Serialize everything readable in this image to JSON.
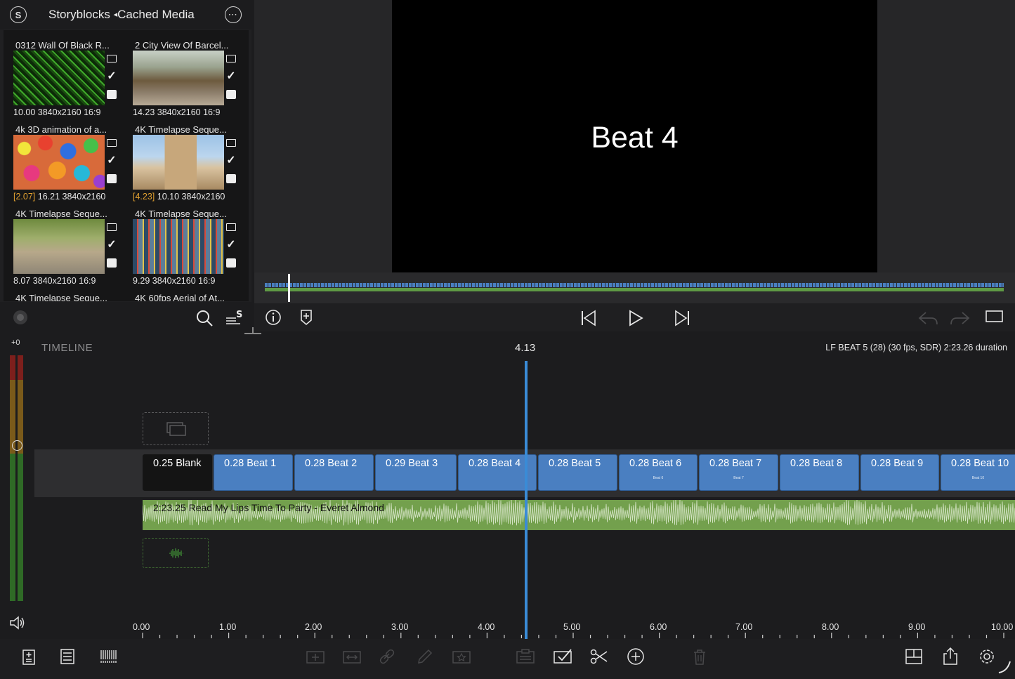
{
  "browser": {
    "title": "Storyblocks",
    "title_arrow": "◂",
    "title_sub": "Cached Media",
    "items": [
      {
        "name": "0312 Wall Of Black R...",
        "tag": "",
        "meta": "10.00  3840x2160  16:9"
      },
      {
        "name": "2 City View Of Barcel...",
        "tag": "",
        "meta": "14.23  3840x2160  16:9"
      },
      {
        "name": "4k 3D animation of a...",
        "tag": "[2.07]",
        "meta": "  16.21  3840x2160"
      },
      {
        "name": "4K Timelapse Seque...",
        "tag": "[4.23]",
        "meta": "  10.10  3840x2160"
      },
      {
        "name": "4K Timelapse Seque...",
        "tag": "",
        "meta": "8.07  3840x2160  16:9"
      },
      {
        "name": "4K Timelapse Seque...",
        "tag": "",
        "meta": "9.29  3840x2160  16:9"
      },
      {
        "name": "4K Timelapse Seque...",
        "tag": "",
        "meta": ""
      },
      {
        "name": "4K 60fps Aerial of At...",
        "tag": "",
        "meta": ""
      }
    ]
  },
  "viewer": {
    "frame_text": "Beat 4"
  },
  "timeline": {
    "label": "TIMELINE",
    "playhead_time": "4.13",
    "project_info": "LF BEAT 5 (28) (30 fps, SDR)  2:23.26 duration",
    "meter_label": "+0",
    "clips": [
      {
        "label": "0.25   Blank",
        "sub": ""
      },
      {
        "label": "0.28   Beat 1",
        "sub": ""
      },
      {
        "label": "0.28   Beat 2",
        "sub": ""
      },
      {
        "label": "0.29   Beat 3",
        "sub": ""
      },
      {
        "label": "0.28   Beat 4",
        "sub": ""
      },
      {
        "label": "0.28   Beat 5",
        "sub": ""
      },
      {
        "label": "0.28   Beat 6",
        "sub": "Beat 6"
      },
      {
        "label": "0.28   Beat 7",
        "sub": "Beat 7"
      },
      {
        "label": "0.28   Beat 8",
        "sub": ""
      },
      {
        "label": "0.28   Beat 9",
        "sub": ""
      },
      {
        "label": "0.28   Beat 10",
        "sub": "Beat 10"
      }
    ],
    "audio_label": "2:23.25  Read My Lips Time To Party - Everet Almond",
    "ruler_labels": [
      "0.00",
      "1.00",
      "2.00",
      "3.00",
      "4.00",
      "5.00",
      "6.00",
      "7.00",
      "8.00",
      "9.00",
      "10.00"
    ]
  },
  "colors": {
    "video_clip": "#4a7fc1",
    "audio_clip": "#7eaa55",
    "playhead": "#3a8bd6",
    "used_tag": "#e0a030"
  },
  "icons": {
    "browser": [
      "storyblocks-icon",
      "more-icon",
      "record-icon",
      "search-icon",
      "sort-icon"
    ],
    "transport": [
      "info-icon",
      "add-marker-icon",
      "skip-back-icon",
      "play-icon",
      "skip-forward-icon",
      "undo-icon",
      "redo-icon",
      "fullscreen-icon"
    ],
    "toolbar": [
      "add-media-icon",
      "list-view-icon",
      "barcode-icon",
      "add-title-icon",
      "add-transition-icon",
      "link-icon",
      "edit-icon",
      "favorite-icon",
      "clipboard-icon",
      "select-icon",
      "split-icon",
      "add-icon",
      "delete-icon",
      "layout-icon",
      "share-icon",
      "settings-icon"
    ]
  }
}
